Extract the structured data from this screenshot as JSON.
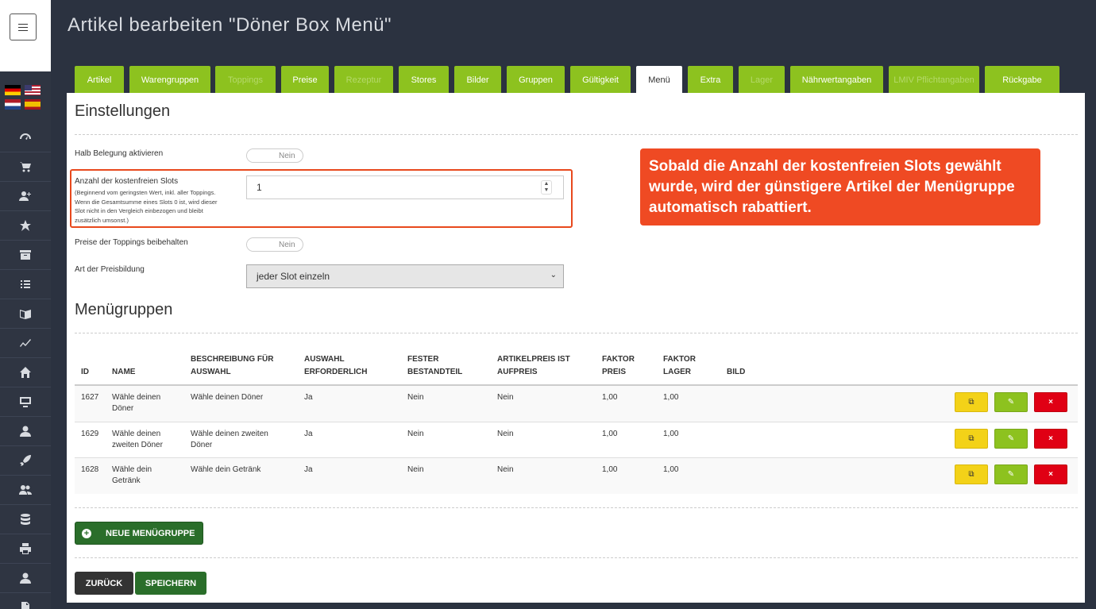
{
  "page": {
    "title": "Artikel bearbeiten \"Döner Box Menü\""
  },
  "sidebar": {
    "flags": [
      "de",
      "us",
      "nl",
      "es"
    ],
    "icons": [
      "dashboard-icon",
      "cart-icon",
      "add-user-icon",
      "star-icon",
      "archive-icon",
      "list-icon",
      "book-icon",
      "chart-icon",
      "home-icon",
      "monitor-icon",
      "user-icon",
      "rocket-icon",
      "users-icon",
      "database-icon",
      "print-icon",
      "user-icon",
      "file-icon"
    ]
  },
  "tabs": [
    {
      "label": "Artikel",
      "state": "normal"
    },
    {
      "label": "Warengruppen",
      "state": "normal"
    },
    {
      "label": "Toppings",
      "state": "disabled"
    },
    {
      "label": "Preise",
      "state": "normal"
    },
    {
      "label": "Rezeptur",
      "state": "disabled"
    },
    {
      "label": "Stores",
      "state": "normal"
    },
    {
      "label": "Bilder",
      "state": "normal"
    },
    {
      "label": "Gruppen",
      "state": "normal"
    },
    {
      "label": "Gültigkeit",
      "state": "normal"
    },
    {
      "label": "Menü",
      "state": "active"
    },
    {
      "label": "Extra",
      "state": "normal"
    },
    {
      "label": "Lager",
      "state": "disabled"
    },
    {
      "label": "Nährwertangaben",
      "state": "normal"
    },
    {
      "label": "LMIV Pflichtangaben",
      "state": "disabled"
    },
    {
      "label": "Rückgabe",
      "state": "normal"
    }
  ],
  "settings": {
    "title": "Einstellungen",
    "half_label": "Halb Belegung aktivieren",
    "half_value": "Nein",
    "free_slots_label": "Anzahl der kostenfreien Slots",
    "free_slots_help": "(Beginnend vom geringsten Wert, inkl. aller Toppings. Wenn die Gesamtsumme eines Slots 0 ist, wird dieser Slot nicht in den Vergleich einbezogen und bleibt zusätzlich umsonst.)",
    "free_slots_value": "1",
    "keep_topping_label": "Preise der Toppings beibehalten",
    "keep_topping_value": "Nein",
    "pricing_label": "Art der Preisbildung",
    "pricing_value": "jeder Slot einzeln"
  },
  "menugroups": {
    "title": "Menügruppen",
    "headers": {
      "id": "ID",
      "name": "NAME",
      "desc1": "BESCHREIBUNG FÜR",
      "desc2": "AUSWAHL",
      "req1": "AUSWAHL",
      "req2": "ERFORDERLICH",
      "fix1": "FESTER",
      "fix2": "BESTANDTEIL",
      "surc1": "ARTIKELPREIS IST",
      "surc2": "AUFPREIS",
      "fp1": "FAKTOR",
      "fp2": "PREIS",
      "fl1": "FAKTOR",
      "fl2": "LAGER",
      "img": "BILD"
    },
    "rows": [
      {
        "id": "1627",
        "name1": "Wähle deinen",
        "name2": "Döner",
        "desc1": "Wähle deinen Döner",
        "desc2": "",
        "required": "Ja",
        "fixed": "Nein",
        "surcharge": "Nein",
        "factor_price": "1,00",
        "factor_stock": "1,00"
      },
      {
        "id": "1629",
        "name1": "Wähle deinen",
        "name2": "zweiten Döner",
        "desc1": "Wähle deinen zweiten",
        "desc2": "Döner",
        "required": "Ja",
        "fixed": "Nein",
        "surcharge": "Nein",
        "factor_price": "1,00",
        "factor_stock": "1,00"
      },
      {
        "id": "1628",
        "name1": "Wähle dein",
        "name2": "Getränk",
        "desc1": "Wähle dein Getränk",
        "desc2": "",
        "required": "Ja",
        "fixed": "Nein",
        "surcharge": "Nein",
        "factor_price": "1,00",
        "factor_stock": "1,00"
      }
    ],
    "new_button": "Neue Menügruppe"
  },
  "footer": {
    "back": "Zurück",
    "save": "Speichern"
  },
  "callout": {
    "text": "Sobald die Anzahl der kostenfreien Slots gewählt wurde, wird der günstigere Artikel der Menügruppe automatisch rabattiert.",
    "color": "#ef4a23"
  },
  "colors": {
    "tab_green": "#8dc21f",
    "dark_green": "#2a6e2a",
    "copy_yellow": "#f3d218",
    "delete_red": "#e00014"
  }
}
